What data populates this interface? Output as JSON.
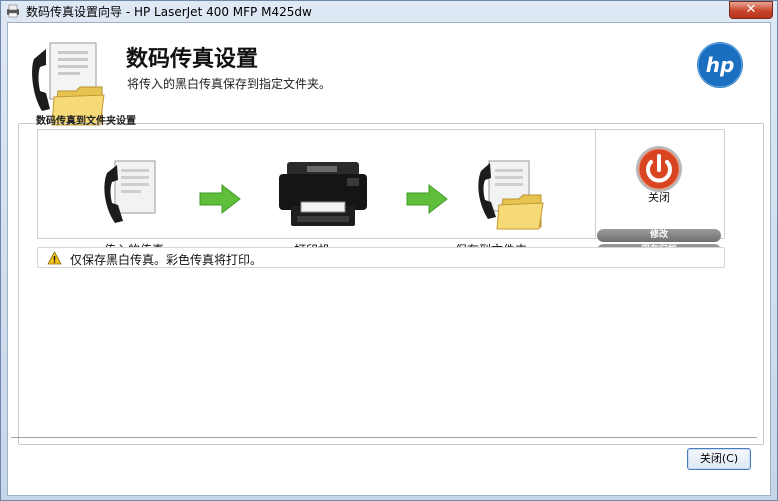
{
  "window": {
    "title": "数码传真设置向导 - HP LaserJet 400 MFP M425dw",
    "close_glyph": "✕"
  },
  "header": {
    "title": "数码传真设置",
    "subtitle": "将传入的黑白传真保存到指定文件夹。",
    "logo_text": "hp",
    "brand_color": "#1a6fc0"
  },
  "section": {
    "label": "数码传真到文件夹设置"
  },
  "flow": {
    "steps": [
      {
        "label": "传入的传真",
        "icon": "fax-phone-icon"
      },
      {
        "label": "打印机",
        "icon": "printer-icon"
      },
      {
        "label": "保存到文件夹",
        "icon": "fax-folder-icon"
      }
    ],
    "arrow_color": "#5fbf3a"
  },
  "actions": {
    "power_label": "关闭",
    "power_color": "#d94521",
    "modify_label": "修改",
    "archive_label": "现在归档"
  },
  "warning": {
    "icon": "warning-icon",
    "text": "仅保存黑白传真。彩色传真将打印。"
  },
  "footer": {
    "close_button": "关闭(C)"
  }
}
